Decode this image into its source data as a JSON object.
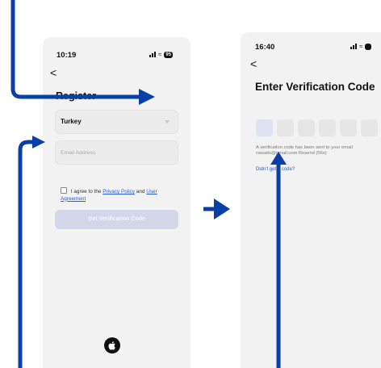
{
  "left_screen": {
    "status_time": "10:19",
    "battery": "95",
    "back": "<",
    "title": "Register",
    "country_value": "Turkey",
    "email_placeholder": "Email Address",
    "agree_prefix": "I agree to the",
    "privacy_link": "Privacy Policy",
    "agree_and": "and",
    "user_agreement_link": "User Agreement",
    "get_code_button": "Get Verification Code",
    "apple_icon": "apple-logo-icon"
  },
  "right_screen": {
    "status_time": "16:40",
    "back": "<",
    "title": "Enter Verification Code",
    "code_boxes": [
      "",
      "",
      "",
      "",
      "",
      ""
    ],
    "sent_line1": "A verification code has been sent to your email",
    "sent_line2": "cwsatis@gmail.com  Resend (56s)",
    "didnt_get": "Didn't get a code?"
  },
  "annotations": {
    "arrow_color": "#0b3fa8"
  }
}
